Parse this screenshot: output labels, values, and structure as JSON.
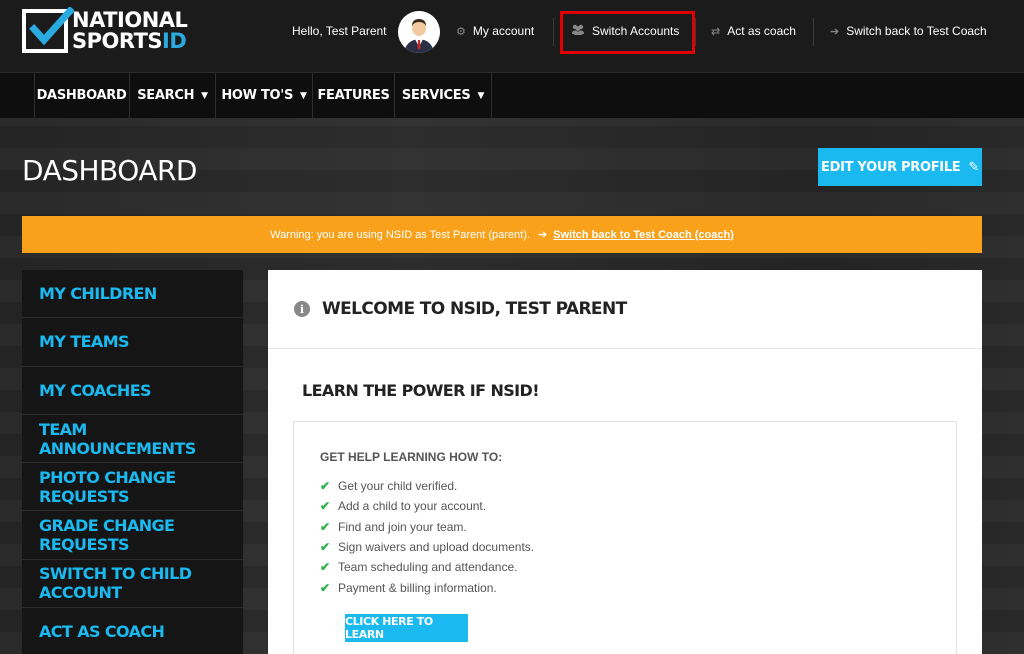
{
  "brand": {
    "logo_line1": "NATIONAL",
    "logo_line2": "SPORTS",
    "logo_line2_suffix": "ID",
    "accent_color": "#1ab9f0",
    "warning_color": "#f9a11b"
  },
  "header": {
    "greeting": "Hello, Test Parent",
    "my_account": "My account",
    "switch_accounts": "Switch Accounts",
    "act_as_coach": "Act as coach",
    "switch_back": "Switch back to Test Coach",
    "icons": {
      "my_account": "gear-icon",
      "switch_accounts": "users-icon",
      "act_as_coach": "swap-icon",
      "switch_back": "sign-out-icon"
    }
  },
  "nav": {
    "items": [
      {
        "label": "DASHBOARD",
        "has_dropdown": false
      },
      {
        "label": "SEARCH",
        "has_dropdown": true
      },
      {
        "label": "HOW TO'S",
        "has_dropdown": true
      },
      {
        "label": "FEATURES",
        "has_dropdown": false
      },
      {
        "label": "SERVICES",
        "has_dropdown": true
      }
    ]
  },
  "page": {
    "title": "DASHBOARD",
    "edit_profile": "EDIT YOUR PROFILE"
  },
  "warning": {
    "text": "Warning: you are using NSID as Test Parent (parent).",
    "link": "Switch back to Test Coach (coach)"
  },
  "sidebar": {
    "items": [
      {
        "label": "MY CHILDREN"
      },
      {
        "label": "MY TEAMS"
      },
      {
        "label": "MY COACHES"
      },
      {
        "label": "TEAM ANNOUNCEMENTS"
      },
      {
        "label": "PHOTO CHANGE REQUESTS"
      },
      {
        "label": "GRADE CHANGE REQUESTS"
      },
      {
        "label": "SWITCH TO CHILD ACCOUNT"
      },
      {
        "label": "ACT AS COACH"
      }
    ]
  },
  "main": {
    "welcome": "WELCOME TO NSID, TEST PARENT",
    "learn_title": "LEARN THE POWER IF NSID!",
    "help_title": "GET HELP LEARNING HOW TO:",
    "help_items": [
      "Get your child verified.",
      "Add a child to your account.",
      "Find and join your team.",
      "Sign waivers and upload documents.",
      "Team scheduling and attendance.",
      "Payment & billing information."
    ],
    "learn_button": "CLICK HERE TO LEARN"
  }
}
